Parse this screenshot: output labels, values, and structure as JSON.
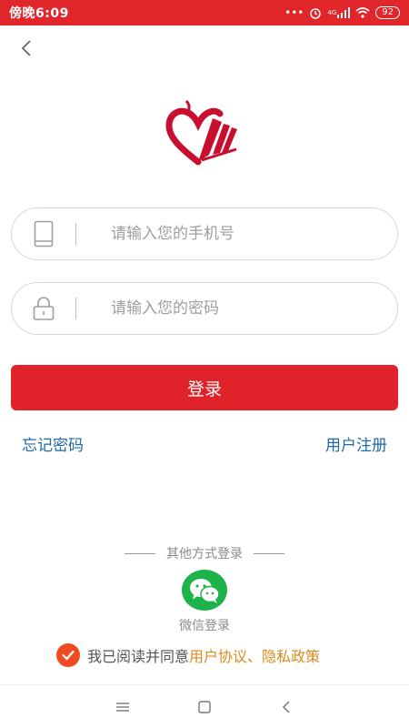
{
  "status_bar": {
    "time": "傍晚6:09",
    "dots": "•••",
    "network": "4G",
    "battery": "92"
  },
  "icons": {
    "back": "back-arrow-icon",
    "logo": "apple-book-logo",
    "phone": "phone-icon",
    "lock": "lock-icon",
    "wechat": "wechat-icon",
    "check": "check-icon"
  },
  "form": {
    "phone_placeholder": "请输入您的手机号",
    "password_placeholder": "请输入您的密码",
    "login_label": "登录"
  },
  "links": {
    "forgot": "忘记密码",
    "register": "用户注册"
  },
  "other": {
    "title": "其他方式登录",
    "wechat_label": "微信登录"
  },
  "agreement": {
    "prefix": "我已阅读并同意",
    "user_agreement": "用户协议",
    "separator": "、",
    "privacy": "隐私政策"
  },
  "colors": {
    "accent": "#e0232a",
    "link": "#1e6aa8",
    "highlight": "#d98a1e",
    "wechat": "#1db34a"
  }
}
